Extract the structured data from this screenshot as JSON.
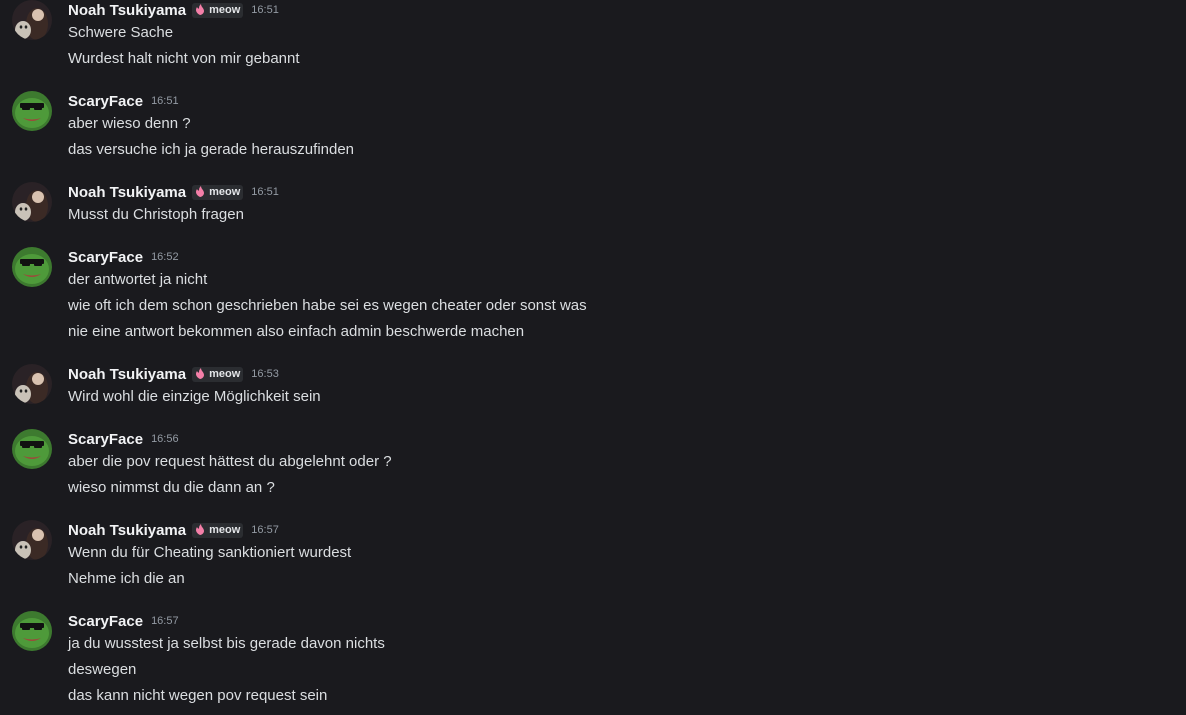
{
  "tag_label": "meow",
  "colors": {
    "background": "#1a1a1e",
    "username": "#f2f3f5",
    "message": "#dbdee1",
    "timestamp": "#949ba4",
    "tag_bg": "#2b2d31",
    "tag_icon": "#f47fa8"
  },
  "messages": [
    {
      "author": "Noah Tsukiyama",
      "avatar": "anime-cat-avatar",
      "tag": true,
      "time": "16:51",
      "lines": [
        "Schwere Sache",
        "Wurdest halt nicht von mir gebannt"
      ]
    },
    {
      "author": "ScaryFace",
      "avatar": "pepe-sunglasses-avatar",
      "tag": false,
      "time": "16:51",
      "lines": [
        "aber wieso denn ?",
        "das versuche ich ja gerade herauszufinden"
      ]
    },
    {
      "author": "Noah Tsukiyama",
      "avatar": "anime-cat-avatar",
      "tag": true,
      "time": "16:51",
      "lines": [
        "Musst du Christoph fragen"
      ]
    },
    {
      "author": "ScaryFace",
      "avatar": "pepe-sunglasses-avatar",
      "tag": false,
      "time": "16:52",
      "lines": [
        "der antwortet ja nicht",
        "wie oft ich dem schon geschrieben habe sei es wegen cheater oder sonst was",
        "nie eine antwort bekommen also einfach admin beschwerde machen"
      ]
    },
    {
      "author": "Noah Tsukiyama",
      "avatar": "anime-cat-avatar",
      "tag": true,
      "time": "16:53",
      "lines": [
        "Wird wohl die einzige Möglichkeit sein"
      ]
    },
    {
      "author": "ScaryFace",
      "avatar": "pepe-sunglasses-avatar",
      "tag": false,
      "time": "16:56",
      "lines": [
        "aber die pov request hättest du abgelehnt oder ?",
        "wieso nimmst du die dann an ?"
      ]
    },
    {
      "author": "Noah Tsukiyama",
      "avatar": "anime-cat-avatar",
      "tag": true,
      "time": "16:57",
      "lines": [
        "Wenn du für Cheating sanktioniert wurdest",
        "Nehme ich die an"
      ]
    },
    {
      "author": "ScaryFace",
      "avatar": "pepe-sunglasses-avatar",
      "tag": false,
      "time": "16:57",
      "lines": [
        "ja du wusstest ja selbst bis gerade davon nichts",
        "deswegen",
        "das kann nicht wegen pov request sein"
      ]
    }
  ]
}
